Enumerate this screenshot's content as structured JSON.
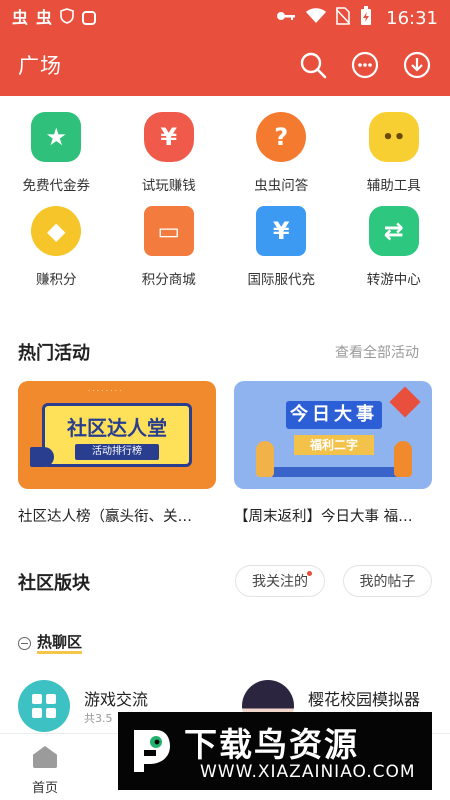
{
  "status": {
    "left_icons": [
      "chong-icon",
      "chong-icon",
      "shield-icon",
      "android-icon"
    ],
    "left_glyphs": [
      "虫",
      "虫"
    ],
    "right_icons": [
      "key-icon",
      "wifi-icon",
      "no-sim-icon",
      "battery-charging-icon"
    ],
    "time": "16:31"
  },
  "header": {
    "title": "广场",
    "icons": [
      "search-icon",
      "message-icon",
      "download-icon"
    ]
  },
  "quick_actions": [
    {
      "label": "免费代金券",
      "icon": "coupon-icon",
      "color": "#2fc17b",
      "glyph": "★"
    },
    {
      "label": "试玩赚钱",
      "icon": "money-bag-icon",
      "color": "#ef5a4b",
      "glyph": "¥"
    },
    {
      "label": "虫虫问答",
      "icon": "question-icon",
      "color": "#f37a2e",
      "glyph": "?"
    },
    {
      "label": "辅助工具",
      "icon": "robot-icon",
      "color": "#f7cf33",
      "glyph": "••"
    },
    {
      "label": "赚积分",
      "icon": "coin-icon",
      "color": "#f6c529",
      "glyph": "◆"
    },
    {
      "label": "积分商城",
      "icon": "store-icon",
      "color": "#f27b3d",
      "glyph": "▭"
    },
    {
      "label": "国际服代充",
      "icon": "wallet-icon",
      "color": "#3d9af3",
      "glyph": "¥"
    },
    {
      "label": "转游中心",
      "icon": "switch-icon",
      "color": "#2ec77f",
      "glyph": "⇄"
    }
  ],
  "hot_events": {
    "title": "热门活动",
    "more": "查看全部活动",
    "cards": [
      {
        "banner_title": "社区达人堂",
        "banner_subtitle": "活动排行榜",
        "caption": "社区达人榜（赢头衔、关…"
      },
      {
        "banner_title": "今日大事",
        "banner_subtitle": "福利二字",
        "caption": "【周末返利】今日大事 福…"
      }
    ]
  },
  "community": {
    "title": "社区版块",
    "filters": [
      {
        "label": "我关注的",
        "has_dot": true
      },
      {
        "label": "我的帖子",
        "has_dot": false
      }
    ],
    "hot_chat_label": "热聊区",
    "boards": [
      {
        "name": "游戏交流",
        "count": "共3.5"
      },
      {
        "name": "樱花校园模拟器",
        "count": ""
      }
    ]
  },
  "bottom_nav": [
    {
      "label": "首页",
      "icon": "home-icon"
    },
    {
      "label": "",
      "icon": "game-icon"
    },
    {
      "label": "",
      "icon": "discover-icon"
    },
    {
      "label": "",
      "icon": "square-icon"
    },
    {
      "label": "",
      "icon": "profile-icon"
    }
  ],
  "watermark": {
    "title": "下载鸟资源",
    "url": "WWW.XIAZAINIAO.COM"
  }
}
